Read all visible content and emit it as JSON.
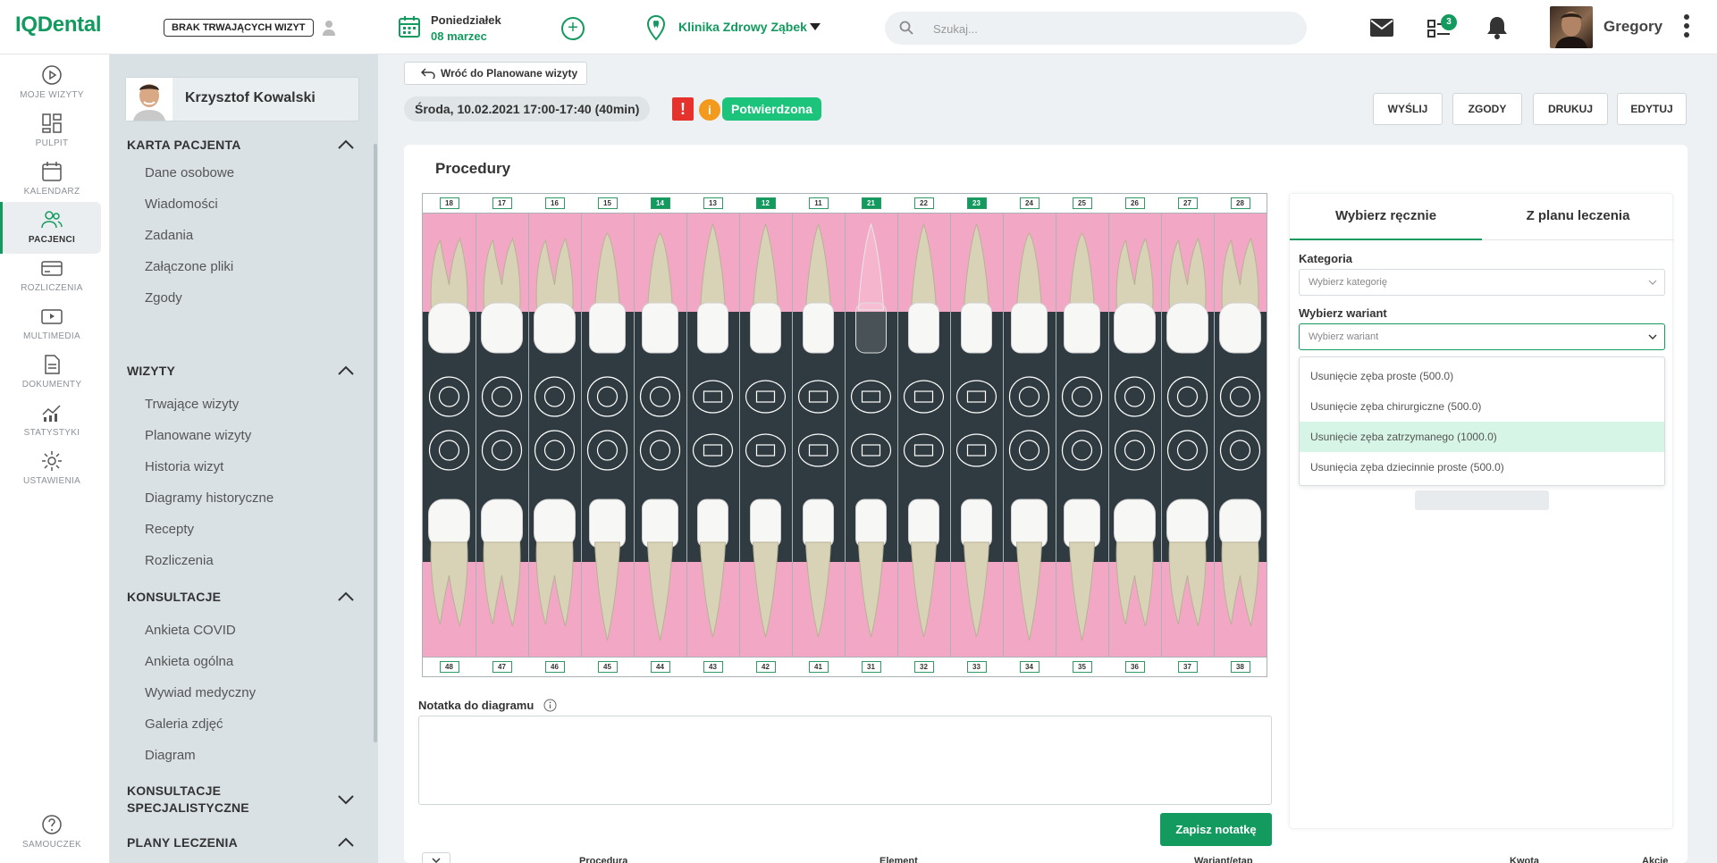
{
  "header": {
    "logo": "IQDental",
    "no_visit_label": "BRAK TRWAJĄCYCH WIZYT",
    "day_name": "Poniedziałek",
    "date": "08 marzec",
    "clinic": "Klinika Zdrowy Ząbek",
    "search_placeholder": "Szukaj...",
    "task_count": "3",
    "username": "Gregory"
  },
  "leftnav": [
    {
      "label": "MOJE WIZYTY",
      "icon": "play-icon"
    },
    {
      "label": "PULPIT",
      "icon": "dashboard-icon"
    },
    {
      "label": "KALENDARZ",
      "icon": "calendar-icon"
    },
    {
      "label": "PACJENCI",
      "icon": "patients-icon",
      "active": true
    },
    {
      "label": "ROZLICZENIA",
      "icon": "card-icon"
    },
    {
      "label": "MULTIMEDIA",
      "icon": "media-icon"
    },
    {
      "label": "DOKUMENTY",
      "icon": "document-icon"
    },
    {
      "label": "STATYSTYKI",
      "icon": "stats-icon"
    },
    {
      "label": "USTAWIENIA",
      "icon": "gear-icon"
    },
    {
      "label": "SAMOUCZEK",
      "icon": "help-icon"
    }
  ],
  "patient": {
    "name": "Krzysztof Kowalski",
    "sections": [
      {
        "title": "KARTA PACJENTA",
        "items": [
          "Dane osobowe",
          "Wiadomości",
          "Zadania",
          "Załączone pliki",
          "Zgody"
        ]
      },
      {
        "title": "WIZYTY",
        "items": [
          "Trwające wizyty",
          "Planowane wizyty",
          "Historia wizyt",
          "Diagramy historyczne",
          "Recepty",
          "Rozliczenia"
        ]
      },
      {
        "title": "KONSULTACJE",
        "items": [
          "Ankieta COVID",
          "Ankieta ogólna",
          "Wywiad medyczny",
          "Galeria zdjęć",
          "Diagram"
        ]
      },
      {
        "title": "KONSULTACJE SPECJALISTYCZNE",
        "items": []
      },
      {
        "title": "PLANY LECZENIA",
        "items": []
      }
    ]
  },
  "visit": {
    "back_label": "Wróć do Planowane wizyty",
    "datetime": "Środa, 10.02.2021 17:00-17:40 (40min)",
    "alert_symbol": "!",
    "info_symbol": "i",
    "status": "Potwierdzona",
    "actions": [
      "WYŚLIJ",
      "ZGODY",
      "DRUKUJ",
      "EDYTUJ"
    ]
  },
  "procedures": {
    "title": "Procedury",
    "upper_teeth": [
      "18",
      "17",
      "16",
      "15",
      "14",
      "13",
      "12",
      "11",
      "21",
      "22",
      "23",
      "24",
      "25",
      "26",
      "27",
      "28"
    ],
    "lower_teeth": [
      "48",
      "47",
      "46",
      "45",
      "44",
      "43",
      "42",
      "41",
      "31",
      "32",
      "33",
      "34",
      "35",
      "36",
      "37",
      "38"
    ],
    "selected_teeth": [
      "14",
      "12",
      "21",
      "23"
    ],
    "note_label": "Notatka do diagramu",
    "save_note": "Zapisz notatkę",
    "table_headers": [
      "Procedura",
      "Element",
      "Wariant/etap",
      "Kwota",
      "Akcje"
    ]
  },
  "selector": {
    "tabs": [
      "Wybierz ręcznie",
      "Z planu leczenia"
    ],
    "category_label": "Kategoria",
    "category_placeholder": "Wybierz kategorię",
    "variant_label": "Wybierz wariant",
    "variant_placeholder": "Wybierz wariant",
    "options": [
      "Usunięcie zęba proste (500.0)",
      "Usunięcie zęba chirurgiczne (500.0)",
      "Usunięcie zęba zatrzymanego (1000.0)",
      "Usunięcia zęba dziecinnie proste (500.0)"
    ],
    "highlighted_option": 2
  },
  "colors": {
    "accent": "#139a5f",
    "status": "#1bc37b",
    "pink": "#f2a8c5",
    "dark": "#2f3b40"
  }
}
